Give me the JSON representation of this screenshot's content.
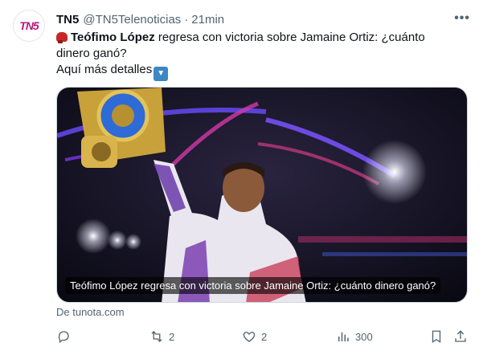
{
  "tweet": {
    "avatar_text": "TN5",
    "author_name": "TN5",
    "handle": "@TN5Telenoticias",
    "separator": "·",
    "time": "21min",
    "more_label": "•••",
    "text_line1": "regresa con victoria sobre Jamaine Ortiz: ¿cuánto dinero ganó?",
    "text_bold": "Teófimo López",
    "text_line2": "Aquí más detalles",
    "card_caption": "Teófimo López regresa con victoria sobre Jamaine Ortiz: ¿cuánto dinero ganó?",
    "source": "De tunota.com"
  },
  "actions": {
    "reply_count": "",
    "retweet_count": "2",
    "like_count": "2",
    "views_count": "300"
  },
  "icons": {
    "glove": "boxing-glove-icon",
    "down": "down-arrow-emoji-icon",
    "reply": "reply-icon",
    "retweet": "retweet-icon",
    "like": "heart-icon",
    "views": "views-icon",
    "bookmark": "bookmark-icon",
    "share": "share-icon",
    "more": "more-icon"
  },
  "colors": {
    "text": "#0f1419",
    "muted": "#536471",
    "avatar_brand": "#b5197c",
    "card_border": "#cfd9de"
  }
}
